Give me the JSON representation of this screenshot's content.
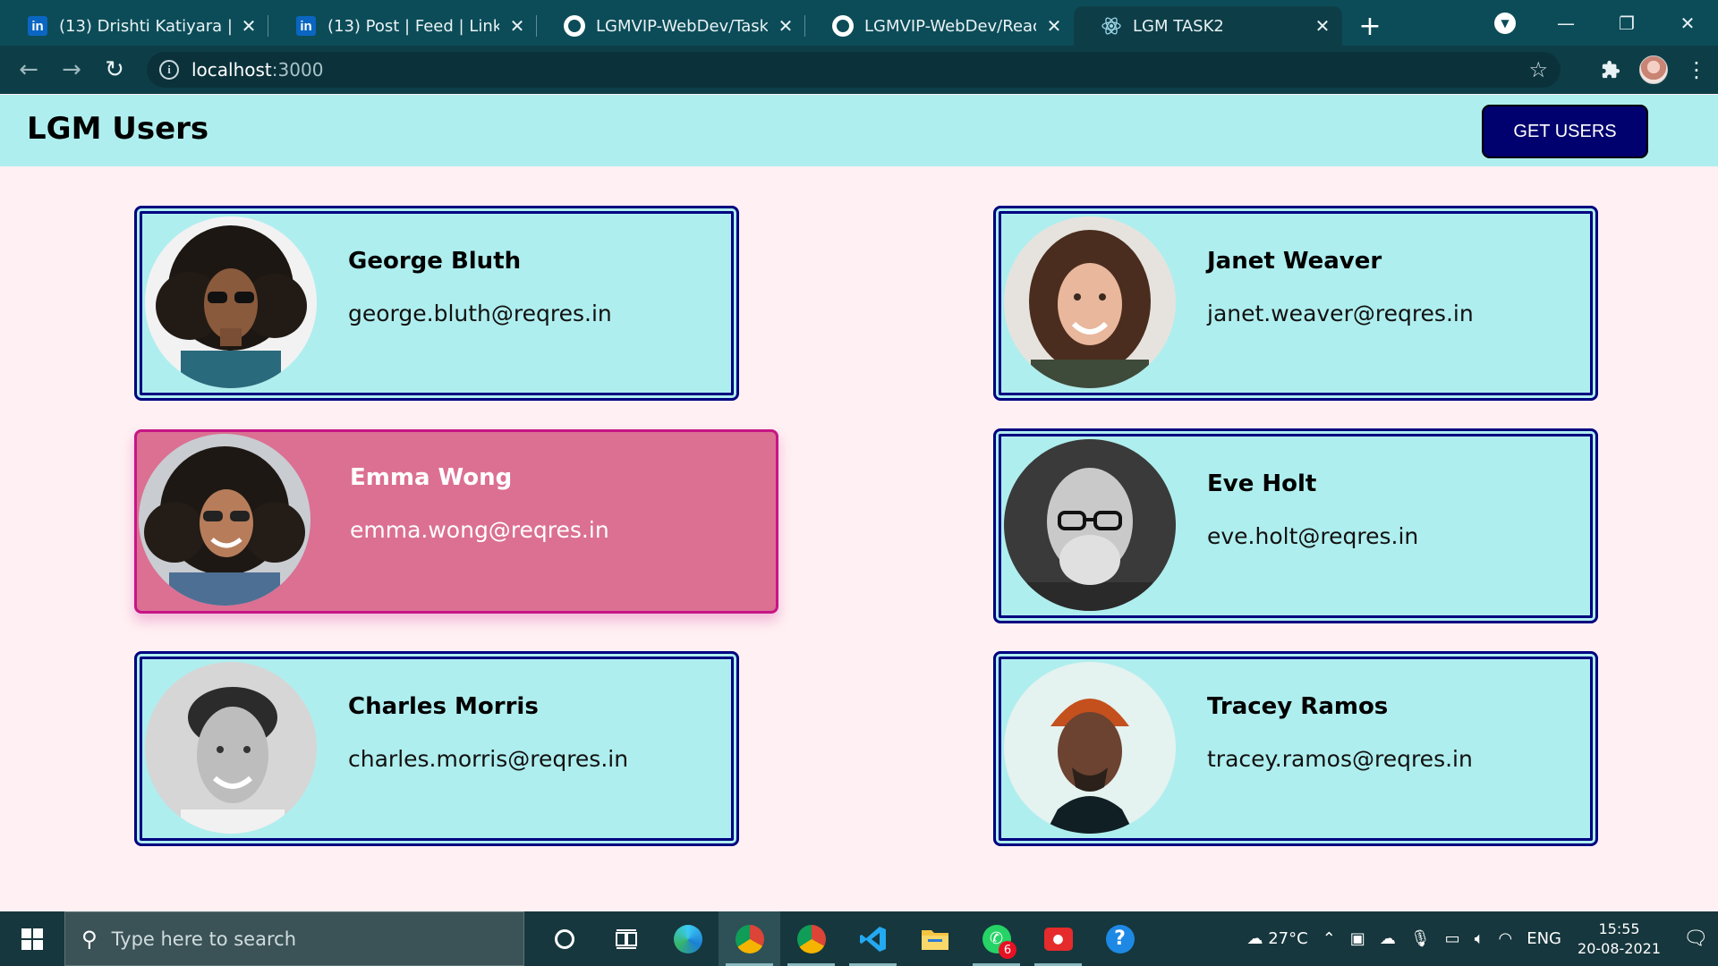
{
  "browser": {
    "tabs": [
      {
        "title": "(13) Drishti Katiyara | LinkedIn",
        "icon": "linkedin-icon",
        "active": false
      },
      {
        "title": "(13) Post | Feed | LinkedIn",
        "icon": "linkedin-icon",
        "active": false
      },
      {
        "title": "LGMVIP-WebDev/Task 2 at",
        "icon": "github-icon",
        "active": false
      },
      {
        "title": "LGMVIP-WebDev/React.jpg",
        "icon": "github-icon",
        "active": false
      },
      {
        "title": "LGM TASK2",
        "icon": "react-icon",
        "active": true
      }
    ],
    "url_host": "localhost",
    "url_port": ":3000"
  },
  "app": {
    "title": "LGM Users",
    "get_users_label": "GET USERS"
  },
  "users": [
    {
      "name": "George Bluth",
      "email": "george.bluth@reqres.in"
    },
    {
      "name": "Janet Weaver",
      "email": "janet.weaver@reqres.in"
    },
    {
      "name": "Emma Wong",
      "email": "emma.wong@reqres.in"
    },
    {
      "name": "Eve Holt",
      "email": "eve.holt@reqres.in"
    },
    {
      "name": "Charles Morris",
      "email": "charles.morris@reqres.in"
    },
    {
      "name": "Tracey Ramos",
      "email": "tracey.ramos@reqres.in"
    }
  ],
  "taskbar": {
    "search_placeholder": "Type here to search",
    "weather": "27°C",
    "language": "ENG",
    "time": "15:55",
    "date": "20-08-2021",
    "whatsapp_badge": "6"
  },
  "colors": {
    "card_bg": "#afeeee",
    "card_border": "#000080",
    "hover_bg": "#db7093",
    "header_bg": "#afeeee",
    "button_bg": "#00006e",
    "page_bg": "#fff0f3"
  }
}
